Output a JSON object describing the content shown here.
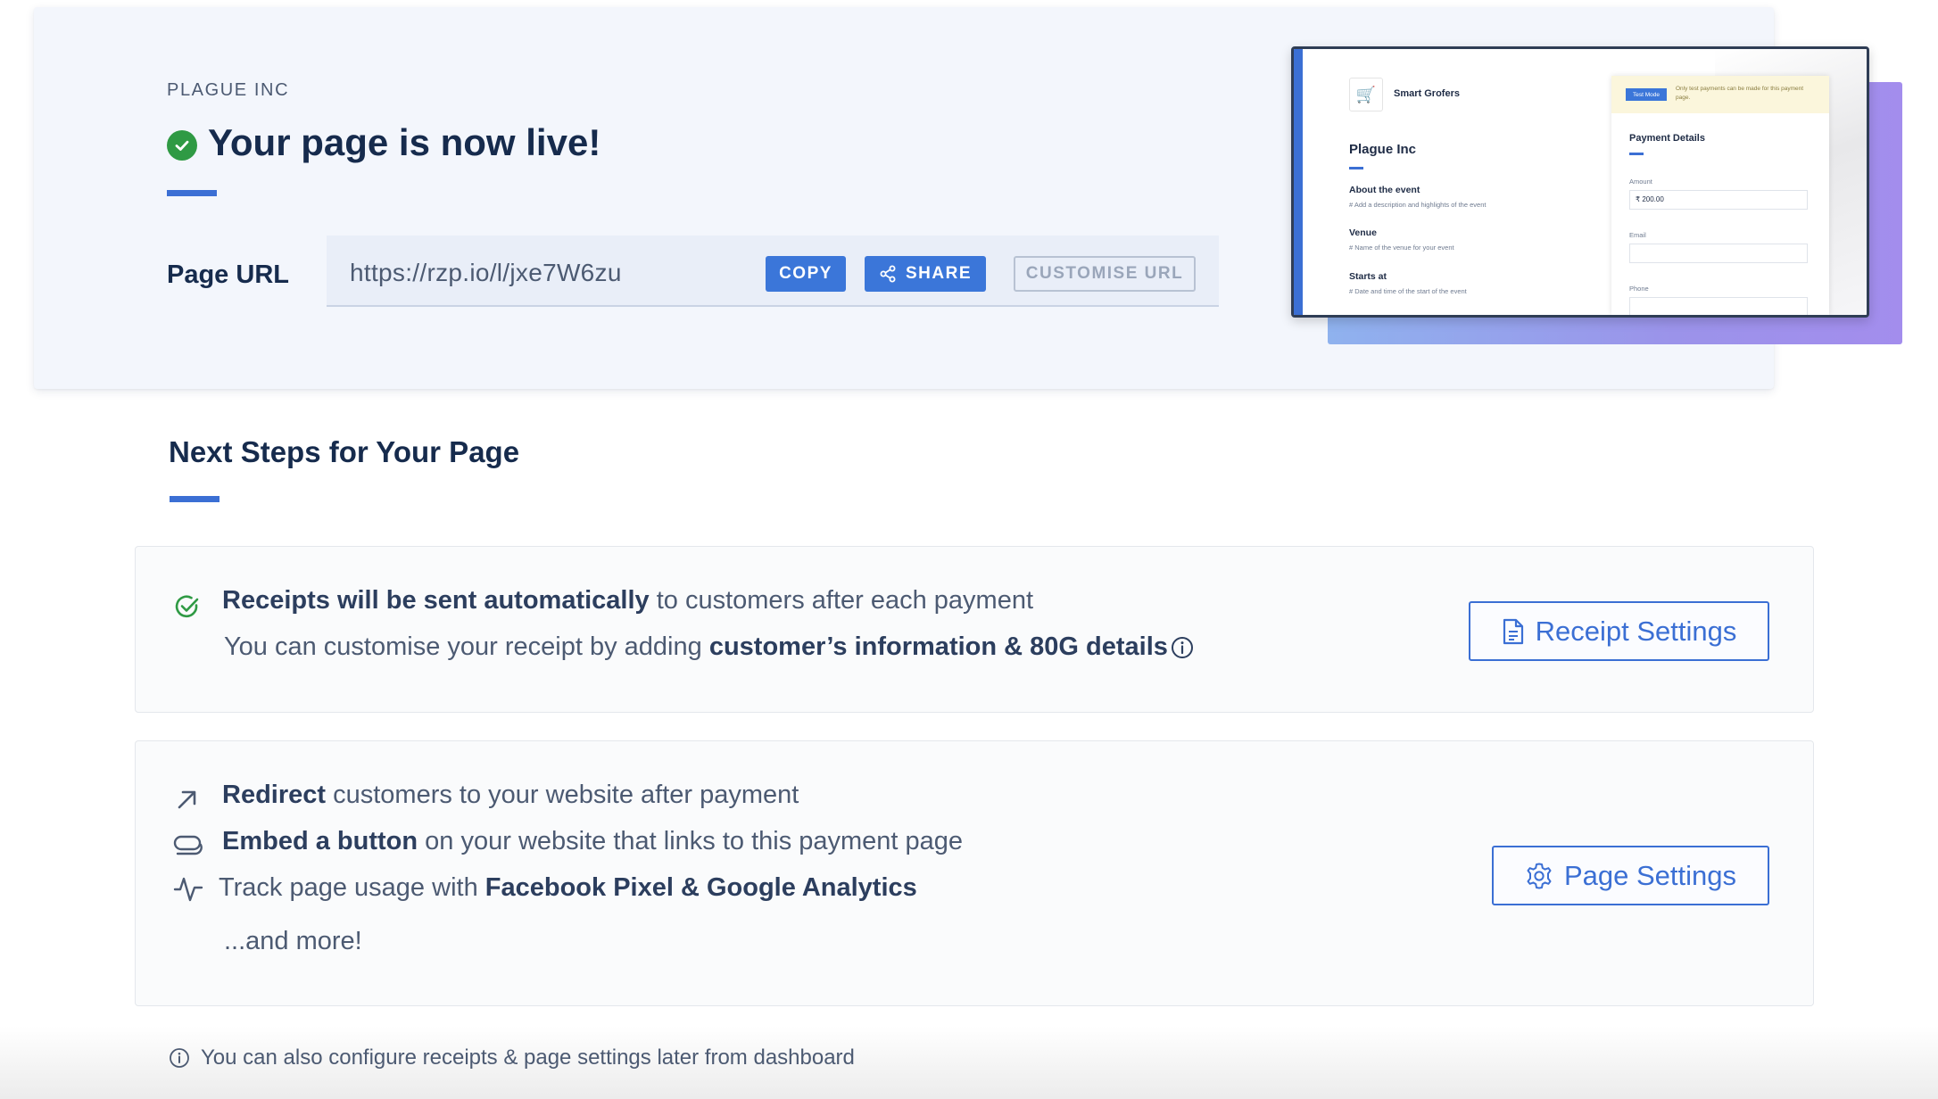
{
  "hero": {
    "merchant_name": "PLAGUE INC",
    "live_title": "Your page is now live!",
    "page_url_label": "Page URL",
    "page_url": "https://rzp.io/l/jxe7W6zu",
    "copy_label": "COPY",
    "share_label": "SHARE",
    "customise_label": "CUSTOMISE URL"
  },
  "preview": {
    "brand_name": "Smart Grofers",
    "page_title": "Plague Inc",
    "sections": [
      {
        "heading": "About the event",
        "hint": "# Add a description and highlights of the event"
      },
      {
        "heading": "Venue",
        "hint": "# Name of the venue for your event"
      },
      {
        "heading": "Starts at",
        "hint": "# Date and time of the start of the event"
      }
    ],
    "test_mode_tag": "Test Mode",
    "test_note": "Only test payments can be made for this payment page.",
    "payment_details_title": "Payment Details",
    "amount_label": "Amount",
    "amount_value": "₹ 200.00",
    "email_label": "Email",
    "phone_label": "Phone"
  },
  "next_steps": {
    "title": "Next Steps for Your Page",
    "receipts": {
      "bold_1": "Receipts will be sent automatically",
      "text_1": " to customers after each payment",
      "text_2": "You can customise your receipt by adding ",
      "bold_2": "customer’s information & 80G details",
      "button_label": "Receipt Settings"
    },
    "page_settings": {
      "redirect_bold": "Redirect",
      "redirect_text": " customers to your website after payment",
      "embed_bold": "Embed a button",
      "embed_text": " on your website that links to this payment page",
      "track_text": "Track page usage with ",
      "track_bold": "Facebook Pixel & Google Analytics",
      "more_text": "...and more!",
      "button_label": "Page Settings"
    }
  },
  "footer": {
    "note": "You can also configure receipts & page settings later from dashboard"
  },
  "colors": {
    "accent": "#3b6fd4",
    "success": "#2f9a44",
    "text_dark": "#162b4d",
    "text_muted": "#4c5a72"
  }
}
